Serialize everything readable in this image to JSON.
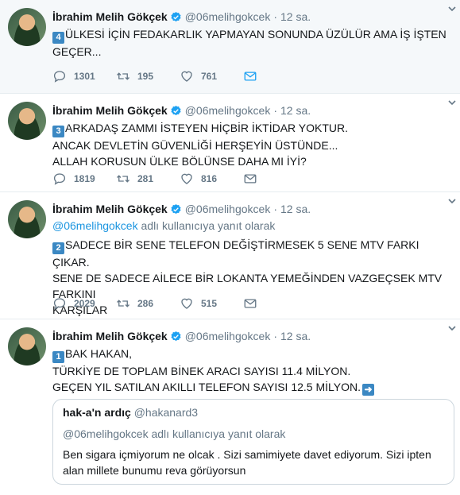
{
  "colors": {
    "link": "#1b95e0",
    "secondary": "#657786",
    "border": "#e6ecf0",
    "keycap": "#3b88c3"
  },
  "tweets": [
    {
      "name": "İbrahim Melih Gökçek",
      "handle": "@06melihgokcek",
      "separator": "·",
      "time": "12 sa.",
      "number_icon": "4",
      "text": "ÜLKESİ İÇİN FEDAKARLIK YAPMAYAN SONUNDA ÜZÜLÜR AMA İŞ İŞTEN GEÇER...",
      "replies": "1301",
      "retweets": "195",
      "likes": "761"
    },
    {
      "name": "İbrahim Melih Gökçek",
      "handle": "@06melihgokcek",
      "separator": "·",
      "time": "12 sa.",
      "number_icon": "3",
      "lines": [
        "ARKADAŞ ZAMMI İSTEYEN HİÇBİR İKTİDAR YOKTUR.",
        "ANCAK DEVLETİN GÜVENLİĞİ HERŞEYİN ÜSTÜNDE...",
        "ALLAH KORUSUN ÜLKE BÖLÜNSE DAHA MI İYİ?"
      ],
      "replies": "1819",
      "retweets": "281",
      "likes": "816"
    },
    {
      "name": "İbrahim Melih Gökçek",
      "handle": "@06melihgokcek",
      "separator": "·",
      "time": "12 sa.",
      "reply_mention": "@06melihgokcek",
      "reply_suffix": " adlı kullanıcıya yanıt olarak",
      "number_icon": "2",
      "lines": [
        "SADECE BİR SENE TELEFON DEĞİŞTİRMESEK 5 SENE MTV FARKI ÇIKAR.",
        "SENE DE SADECE AİLECE BİR LOKANTA YEMEĞİNDEN VAZGEÇSEK MTV FARKINI",
        "KARŞILAR"
      ],
      "replies": "2029",
      "retweets": "286",
      "likes": "515"
    },
    {
      "name": "İbrahim Melih Gökçek",
      "handle": "@06melihgokcek",
      "separator": "·",
      "time": "12 sa.",
      "number_icon": "1",
      "lines": [
        "BAK HAKAN,",
        "TÜRKİYE DE TOPLAM BİNEK ARACI SAYISI 11.4 MİLYON.",
        "GEÇEN YIL SATILAN AKILLI TELEFON SAYISI 12.5 MİLYON."
      ],
      "quote": {
        "name": "hak-a'n ardıç",
        "handle": "@hakanard3",
        "reply_text": "@06melihgokcek adlı kullanıcıya yanıt olarak",
        "lines": [
          "Ben sigara içmiyorum ne olcak . Sizi samimiyete davet ediyorum. Sizi ipten",
          "alan millete bunumu reva görüyorsun"
        ]
      }
    }
  ]
}
